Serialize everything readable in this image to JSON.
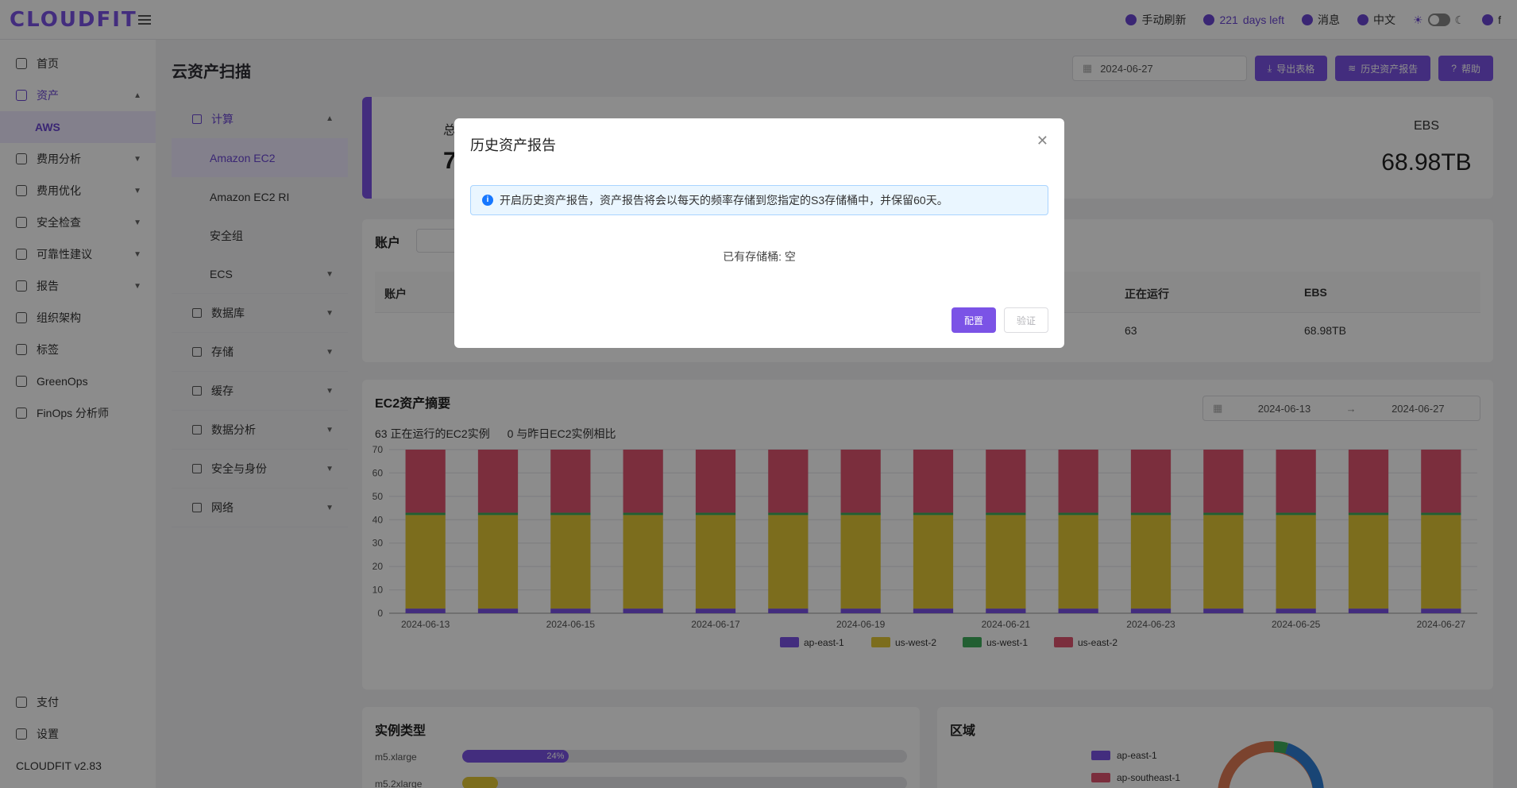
{
  "app": {
    "logo": "CLOUDFIT",
    "version": "CLOUDFIT v2.83"
  },
  "topbar": {
    "refresh": "手动刷新",
    "days_num": "221",
    "days_text": "days left",
    "messages": "消息",
    "language": "中文",
    "user": "f"
  },
  "sidebar": {
    "items": [
      {
        "label": "首页"
      },
      {
        "label": "资产"
      },
      {
        "label": "费用分析"
      },
      {
        "label": "费用优化"
      },
      {
        "label": "安全检查"
      },
      {
        "label": "可靠性建议"
      },
      {
        "label": "报告"
      },
      {
        "label": "组织架构"
      },
      {
        "label": "标签"
      },
      {
        "label": "GreenOps"
      },
      {
        "label": "FinOps 分析师"
      }
    ],
    "sub_active": "AWS",
    "bottom": [
      {
        "label": "支付"
      },
      {
        "label": "设置"
      }
    ]
  },
  "page": {
    "title": "云资产扫描",
    "date": "2024-06-27",
    "export_btn": "导出表格",
    "history_btn": "历史资产报告",
    "help_btn": "帮助"
  },
  "subnav": {
    "compute": "计算",
    "compute_items": [
      "Amazon EC2",
      "Amazon EC2 RI",
      "安全组",
      "ECS"
    ],
    "groups": [
      "数据库",
      "存储",
      "缓存",
      "数据分析",
      "安全与身份",
      "网络"
    ]
  },
  "summary": {
    "left_label": "总",
    "left_value": "7",
    "ebs_label": "EBS",
    "ebs_value": "68.98TB"
  },
  "accounts": {
    "title": "账户",
    "headers": {
      "account": "账户",
      "running": "正在运行",
      "ebs": "EBS"
    },
    "row": {
      "running": "63",
      "ebs": "68.98TB"
    }
  },
  "ec2": {
    "title": "EC2资产摘要",
    "running_text": "63 正在运行的EC2实例",
    "compare_text": "0 与昨日EC2实例相比",
    "range_start": "2024-06-13",
    "range_end": "2024-06-27"
  },
  "chart_data": {
    "type": "bar",
    "stacked": true,
    "categories": [
      "2024-06-13",
      "2024-06-14",
      "2024-06-15",
      "2024-06-16",
      "2024-06-17",
      "2024-06-18",
      "2024-06-19",
      "2024-06-20",
      "2024-06-21",
      "2024-06-22",
      "2024-06-23",
      "2024-06-24",
      "2024-06-25",
      "2024-06-26",
      "2024-06-27"
    ],
    "tick_labels": [
      "2024-06-13",
      "2024-06-15",
      "2024-06-17",
      "2024-06-19",
      "2024-06-21",
      "2024-06-23",
      "2024-06-25",
      "2024-06-27"
    ],
    "ylim": [
      0,
      70
    ],
    "yticks": [
      0,
      10,
      20,
      30,
      40,
      50,
      60,
      70
    ],
    "legend_position": "bottom",
    "series": [
      {
        "name": "ap-east-1",
        "color": "#7b53e6",
        "values": [
          2,
          2,
          2,
          2,
          2,
          2,
          2,
          2,
          2,
          2,
          2,
          2,
          2,
          2,
          2
        ]
      },
      {
        "name": "us-west-2",
        "color": "#e2c636",
        "values": [
          40,
          40,
          40,
          40,
          40,
          40,
          40,
          40,
          40,
          40,
          40,
          40,
          40,
          40,
          40
        ]
      },
      {
        "name": "us-west-1",
        "color": "#3fae5b",
        "values": [
          1,
          1,
          1,
          1,
          1,
          1,
          1,
          1,
          1,
          1,
          1,
          1,
          1,
          1,
          1
        ]
      },
      {
        "name": "us-east-2",
        "color": "#e05570",
        "values": [
          27,
          27,
          27,
          27,
          27,
          27,
          27,
          27,
          27,
          27,
          27,
          27,
          27,
          27,
          27
        ]
      }
    ]
  },
  "instance_types": {
    "title": "实例类型",
    "rows": [
      {
        "name": "m5.xlarge",
        "pct_label": "24%",
        "fraction": 0.24,
        "color": "#7b53e6"
      },
      {
        "name": "m5.2xlarge",
        "pct_label": "",
        "fraction": 0.08,
        "color": "#e2c636"
      }
    ]
  },
  "regions": {
    "title": "区域",
    "legend": [
      {
        "name": "ap-east-1",
        "color": "#7b53e6"
      },
      {
        "name": "ap-southeast-1",
        "color": "#e05570"
      }
    ]
  },
  "modal": {
    "title": "历史资产报告",
    "info": "开启历史资产报告，资产报告将会以每天的频率存储到您指定的S3存储桶中，并保留60天。",
    "bucket_text": "已有存储桶: 空",
    "configure_btn": "配置",
    "verify_btn": "验证"
  }
}
